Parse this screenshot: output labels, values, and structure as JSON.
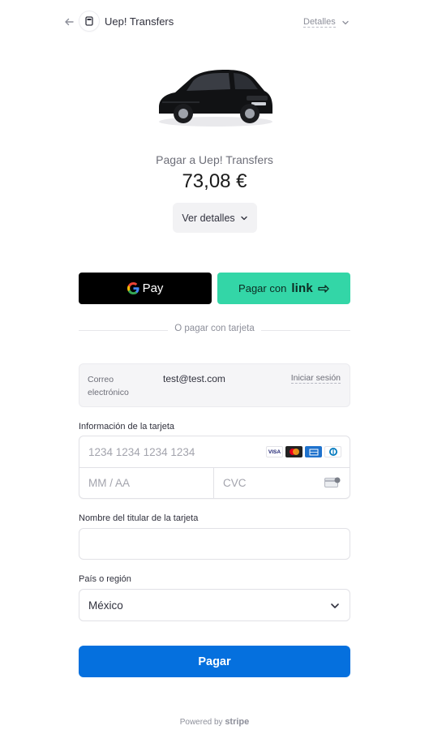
{
  "header": {
    "merchant_name": "Uep! Transfers",
    "details_label": "Detalles"
  },
  "summary": {
    "pay_to": "Pagar a Uep! Transfers",
    "amount": "73,08 €",
    "view_details_label": "Ver detalles"
  },
  "express": {
    "gpay_label": "Pay",
    "link_prefix": "Pagar con",
    "link_brand": "link",
    "divider_text": "O pagar con tarjeta"
  },
  "email": {
    "label": "Correo electrónico",
    "value": "test@test.com",
    "login_label": "Iniciar sesión"
  },
  "card": {
    "section_label": "Información de la tarjeta",
    "number_placeholder": "1234 1234 1234 1234",
    "expiry_placeholder": "MM / AA",
    "cvc_placeholder": "CVC",
    "brands": [
      "visa",
      "mastercard",
      "amex",
      "diners"
    ]
  },
  "cardholder": {
    "section_label": "Nombre del titular de la tarjeta",
    "value": ""
  },
  "country": {
    "section_label": "País o región",
    "selected": "México"
  },
  "submit": {
    "label": "Pagar"
  },
  "footer": {
    "powered_prefix": "Powered by",
    "powered_brand": "stripe"
  },
  "colors": {
    "primary": "#0570de",
    "link_green": "#33d6a7",
    "gpay_black": "#000000"
  }
}
